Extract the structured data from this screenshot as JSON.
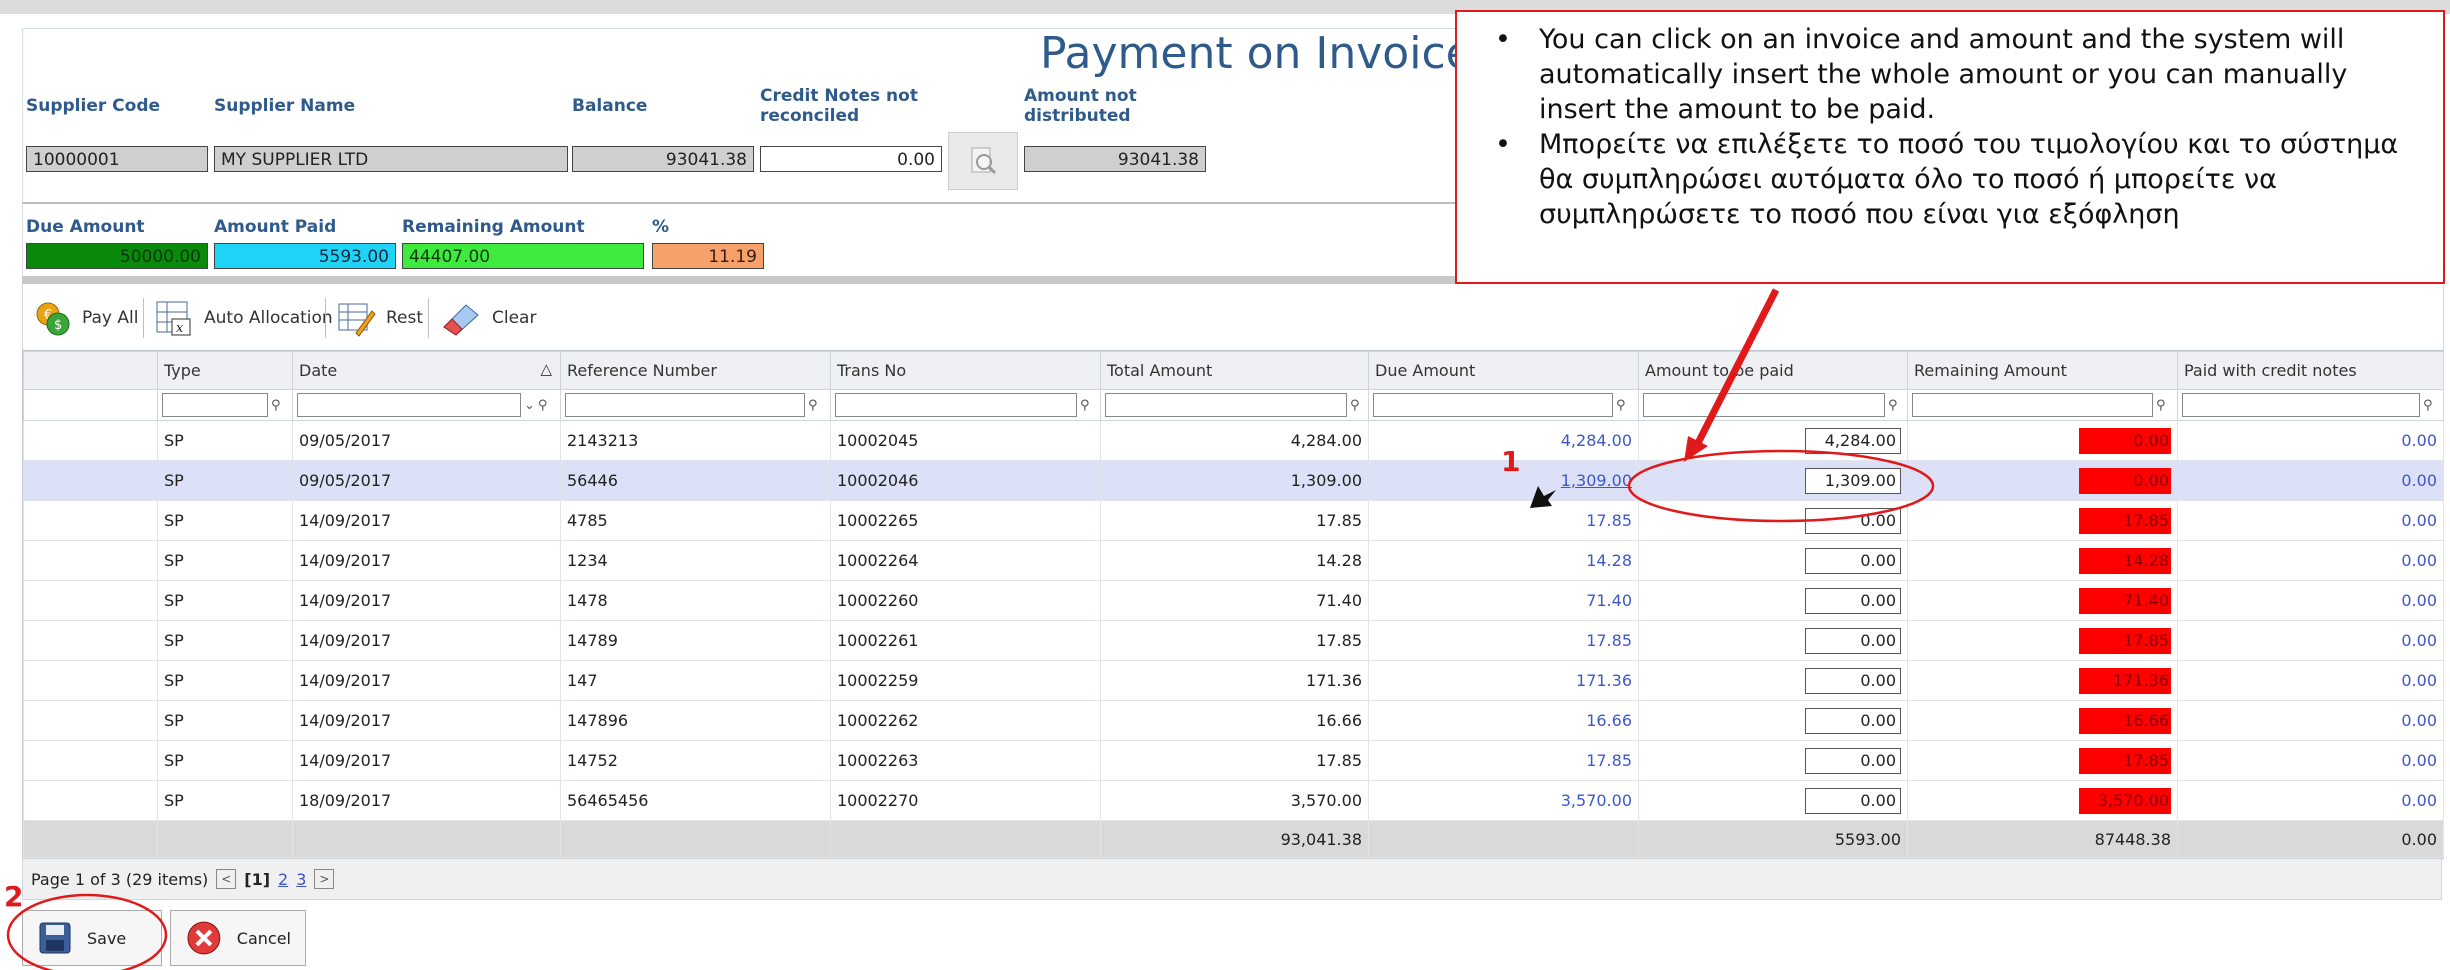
{
  "form": {
    "title": "Payment on Invoice",
    "labels": {
      "supplier_code": "Supplier Code",
      "supplier_name": "Supplier Name",
      "balance": "Balance",
      "credit_notes": "Credit Notes not reconciled",
      "amount_not_distributed": "Amount not distributed",
      "due_amount": "Due Amount",
      "amount_paid": "Amount Paid",
      "remaining_amount": "Remaining Amount",
      "percent": "%"
    },
    "values": {
      "supplier_code": "10000001",
      "supplier_name": "MY SUPPLIER LTD",
      "balance": "93041.38",
      "credit_notes": "0.00",
      "amount_not_distributed": "93041.38",
      "due_amount": "50000.00",
      "amount_paid": "5593.00",
      "remaining_amount": "44407.00",
      "percent": "11.19"
    },
    "colors": {
      "due_amount": "#0a8a0a",
      "amount_paid": "#1fd3f7",
      "remaining_amount": "#3dea3d",
      "percent": "#f6a06a"
    }
  },
  "toolbar": {
    "pay_all": "Pay All",
    "auto_allocation": "Auto Allocation",
    "rest": "Rest",
    "clear": "Clear"
  },
  "grid": {
    "columns": [
      "Type",
      "Date",
      "Reference Number",
      "Trans No",
      "Total Amount",
      "Due Amount",
      "Amount to be paid",
      "Remaining Amount",
      "Paid with credit notes"
    ],
    "rows": [
      {
        "type": "SP",
        "date": "09/05/2017",
        "ref": "2143213",
        "trans": "10002045",
        "total": "4,284.00",
        "due": "4,284.00",
        "pay": "4,284.00",
        "remaining": "0.00",
        "credit": "0.00"
      },
      {
        "type": "SP",
        "date": "09/05/2017",
        "ref": "56446",
        "trans": "10002046",
        "total": "1,309.00",
        "due": "1,309.00",
        "pay": "1,309.00",
        "remaining": "0.00",
        "credit": "0.00"
      },
      {
        "type": "SP",
        "date": "14/09/2017",
        "ref": "4785",
        "trans": "10002265",
        "total": "17.85",
        "due": "17.85",
        "pay": "0.00",
        "remaining": "17.85",
        "credit": "0.00"
      },
      {
        "type": "SP",
        "date": "14/09/2017",
        "ref": "1234",
        "trans": "10002264",
        "total": "14.28",
        "due": "14.28",
        "pay": "0.00",
        "remaining": "14.28",
        "credit": "0.00"
      },
      {
        "type": "SP",
        "date": "14/09/2017",
        "ref": "1478",
        "trans": "10002260",
        "total": "71.40",
        "due": "71.40",
        "pay": "0.00",
        "remaining": "71.40",
        "credit": "0.00"
      },
      {
        "type": "SP",
        "date": "14/09/2017",
        "ref": "14789",
        "trans": "10002261",
        "total": "17.85",
        "due": "17.85",
        "pay": "0.00",
        "remaining": "17.85",
        "credit": "0.00"
      },
      {
        "type": "SP",
        "date": "14/09/2017",
        "ref": "147",
        "trans": "10002259",
        "total": "171.36",
        "due": "171.36",
        "pay": "0.00",
        "remaining": "171.36",
        "credit": "0.00"
      },
      {
        "type": "SP",
        "date": "14/09/2017",
        "ref": "147896",
        "trans": "10002262",
        "total": "16.66",
        "due": "16.66",
        "pay": "0.00",
        "remaining": "16.66",
        "credit": "0.00"
      },
      {
        "type": "SP",
        "date": "14/09/2017",
        "ref": "14752",
        "trans": "10002263",
        "total": "17.85",
        "due": "17.85",
        "pay": "0.00",
        "remaining": "17.85",
        "credit": "0.00"
      },
      {
        "type": "SP",
        "date": "18/09/2017",
        "ref": "56465456",
        "trans": "10002270",
        "total": "3,570.00",
        "due": "3,570.00",
        "pay": "0.00",
        "remaining": "3,570.00",
        "credit": "0.00"
      }
    ],
    "totals": {
      "total": "93,041.38",
      "pay": "5593.00",
      "remaining": "87448.38",
      "credit": "0.00"
    }
  },
  "pager": {
    "info": "Page 1 of 3 (29 items)",
    "current": "[1]",
    "page2": "2",
    "page3": "3"
  },
  "buttons": {
    "save": "Save",
    "cancel": "Cancel"
  },
  "annotation": {
    "bullet_en": "You can click on an invoice and amount and the system will automatically insert the whole amount or you can manually insert the amount to be paid.",
    "bullet_el": "Μπορείτε να επιλέξετε το ποσό του τιμολογίου και το σύστημα θα συμπληρώσει αυτόματα όλο το ποσό ή μπορείτε να συμπληρώσετε το ποσό που είναι για εξόφληση",
    "marker1": "1",
    "marker2": "2"
  }
}
